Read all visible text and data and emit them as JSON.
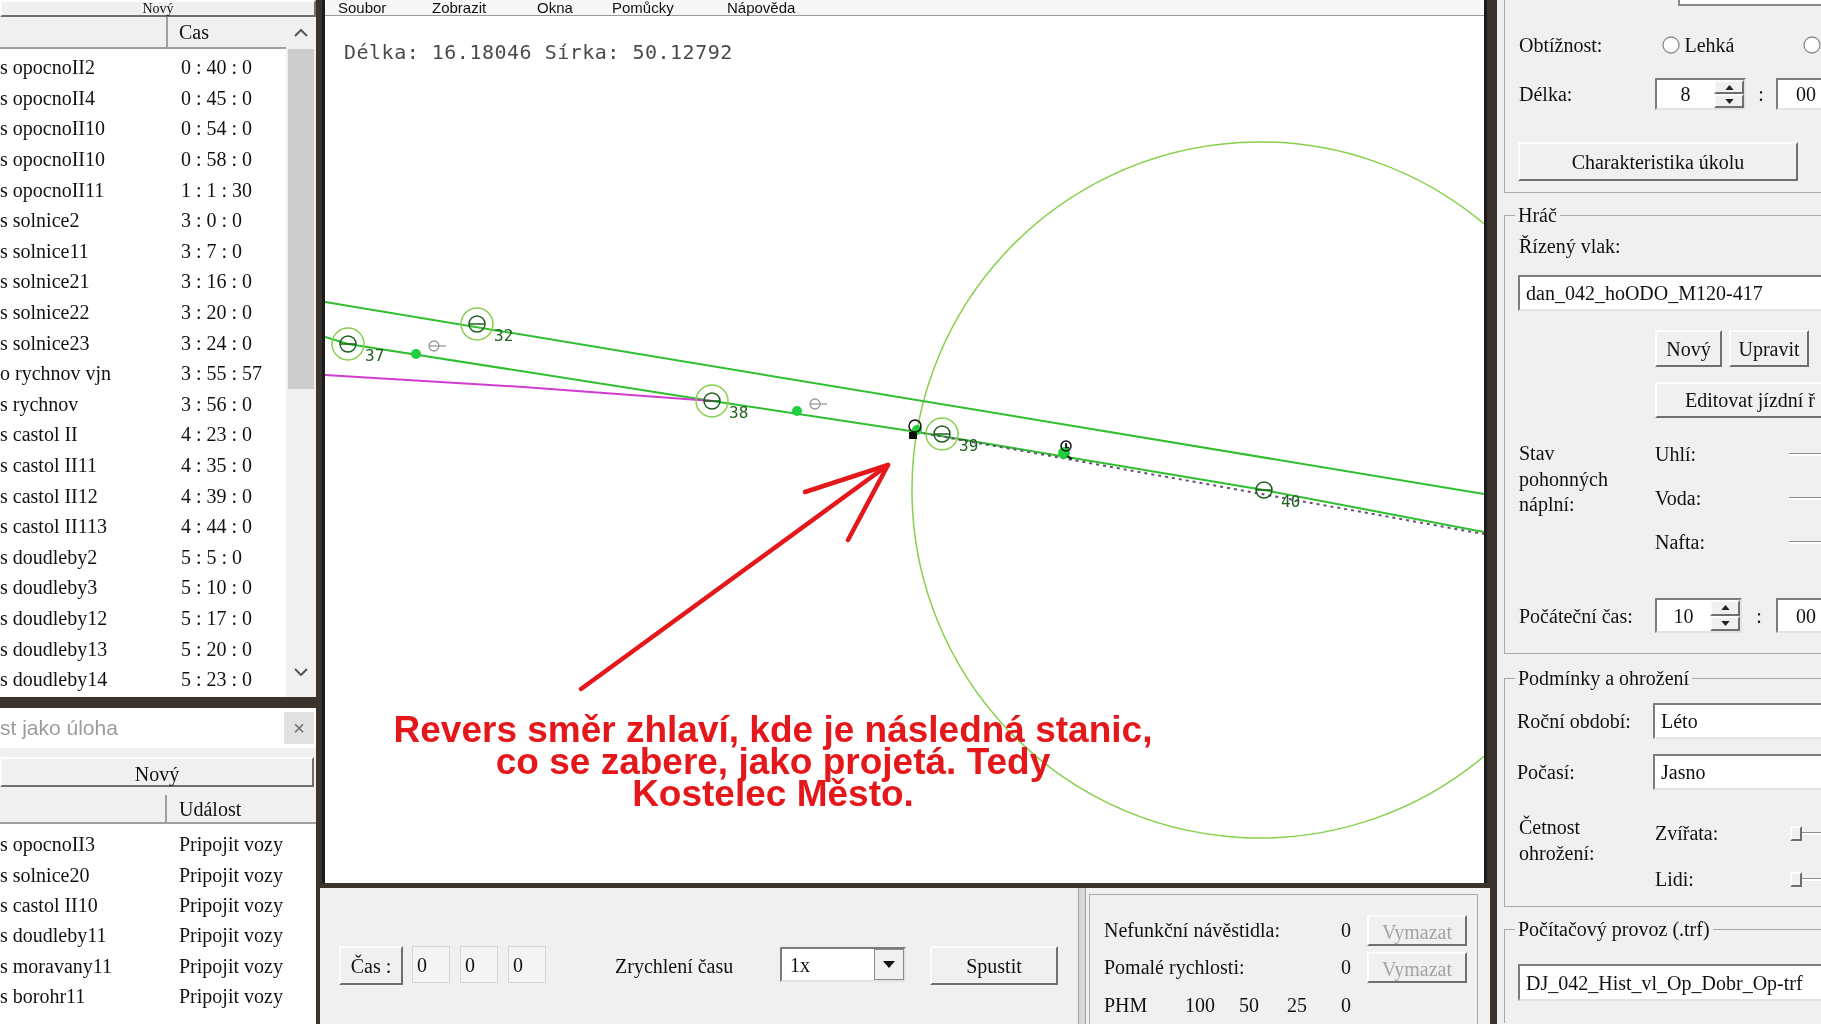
{
  "menu_bar": {
    "items": [
      "Soubor",
      "Zobrazit",
      "Okna",
      "Pomůcky",
      "Nápověda"
    ]
  },
  "schedule_window": {
    "new_button": "Nový",
    "headers": [
      "Cas"
    ],
    "rows": [
      {
        "column_1": "s opocnoII2",
        "time": "0 : 40 : 0"
      },
      {
        "column_1": "s opocnoII4",
        "time": "0 : 45 : 0"
      },
      {
        "column_1": "s opocnoII10",
        "time": "0 : 54 : 0"
      },
      {
        "column_1": "s opocnoII10",
        "time": "0 : 58 : 0"
      },
      {
        "column_1": "s opocnoII11",
        "time": "1 : 1 : 30"
      },
      {
        "column_1": "s solnice2",
        "time": "3 : 0 : 0"
      },
      {
        "column_1": "s solnice11",
        "time": "3 : 7 : 0"
      },
      {
        "column_1": "s solnice21",
        "time": "3 : 16 : 0"
      },
      {
        "column_1": "s solnice22",
        "time": "3 : 20 : 0"
      },
      {
        "column_1": "s solnice23",
        "time": "3 : 24 : 0"
      },
      {
        "column_1": "o rychnov vjn",
        "time": "3 : 55 : 57"
      },
      {
        "column_1": "s rychnov",
        "time": "3 : 56 : 0"
      },
      {
        "column_1": "s castol II",
        "time": "4 : 23 : 0"
      },
      {
        "column_1": "s castol II11",
        "time": "4 : 35 : 0"
      },
      {
        "column_1": "s castol II12",
        "time": "4 : 39 : 0"
      },
      {
        "column_1": "s castol II113",
        "time": "4 : 44 : 0"
      },
      {
        "column_1": "s doudleby2",
        "time": "5 : 5 : 0"
      },
      {
        "column_1": "s doudleby3",
        "time": "5 : 10 : 0"
      },
      {
        "column_1": "s doudleby12",
        "time": "5 : 17 : 0"
      },
      {
        "column_1": "s doudleby13",
        "time": "5 : 20 : 0"
      },
      {
        "column_1": "s doudleby14",
        "time": "5 : 23 : 0"
      }
    ]
  },
  "task_window": {
    "title": "st jako úloha",
    "close": "×",
    "new_button": "Nový",
    "headers": [
      "Událost"
    ],
    "rows": [
      {
        "column_1": "s opocnoII3",
        "event": "Pripojit vozy"
      },
      {
        "column_1": "s solnice20",
        "event": "Pripojit vozy"
      },
      {
        "column_1": "s castol II10",
        "event": "Pripojit vozy"
      },
      {
        "column_1": "s doudleby11",
        "event": "Pripojit vozy"
      },
      {
        "column_1": "s moravany11",
        "event": "Pripojit vozy"
      },
      {
        "column_1": "s borohr11",
        "event": "Pripojit vozy"
      }
    ]
  },
  "map": {
    "coordinates": "Délka: 16.18046 Sírka: 50.12792",
    "markers": [
      {
        "label": "37",
        "ringed": true
      },
      {
        "label": "32",
        "ringed": true
      },
      {
        "label": "38",
        "ringed": true
      },
      {
        "label": "39",
        "ringed": true
      },
      {
        "label": "40",
        "ringed": false
      }
    ],
    "annotation": "Revers směr zhlaví, kde je následná stanic,\nco se zabere, jako projetá. Tedy\nKostelec Město."
  },
  "time_controls": {
    "time_button": "Čas :",
    "time_fields": [
      "0",
      "0",
      "0"
    ],
    "speed_label": "Zrychlení času",
    "speed_value": "1x",
    "start_button": "Spustit"
  },
  "counters": {
    "rows": [
      {
        "label": "Nefunkční návěstidla:",
        "value": "0",
        "button": "Vymazat",
        "disabled": true
      },
      {
        "label": "Pomalé rychlosti:",
        "value": "0",
        "button": "Vymazat",
        "disabled": true
      }
    ],
    "fuel_label": "PHM",
    "fuel_values": [
      "100",
      "50",
      "25",
      "0"
    ]
  },
  "task": {
    "difficulty_label": "Obtížnost:",
    "difficulty_options": [
      {
        "label": "Lehká",
        "selected": false
      },
      {
        "selected": false
      }
    ],
    "length_label": "Délka:",
    "length_hours": "8",
    "length_separator": ":",
    "length_minutes": "00",
    "characteristics_button": "Charakteristika úkolu"
  },
  "player": {
    "title": "Hráč",
    "train_label": "Řízený vlak:",
    "train_value": "dan_042_hoODO_M120-417",
    "buttons": [
      "Nový",
      "Upravit"
    ],
    "timetable_button": "Editovat jízdní ř",
    "fills_label": "Stav pohonných náplní:",
    "fills": [
      {
        "label": "Uhlí:"
      },
      {
        "label": "Voda:"
      },
      {
        "label": "Nafta:"
      }
    ],
    "start_time_label": "Počáteční čas:",
    "start_hours": "10",
    "start_separator": ":",
    "start_minutes": "00"
  },
  "conditions": {
    "title": "Podmínky a ohrožení",
    "season_label": "Roční období:",
    "season_value": "Léto",
    "weather_label": "Počasí:",
    "weather_value": "Jasno",
    "threats_label": "Četnost ohrožení:",
    "threats": [
      {
        "label": "Zvířata:",
        "level": 0
      },
      {
        "label": "Lidi:",
        "level": 0
      }
    ]
  },
  "traffic": {
    "title": "Počítačový provoz (.trf)",
    "file_value": "DJ_042_Hist_vl_Op_Dobr_Op-trf"
  }
}
